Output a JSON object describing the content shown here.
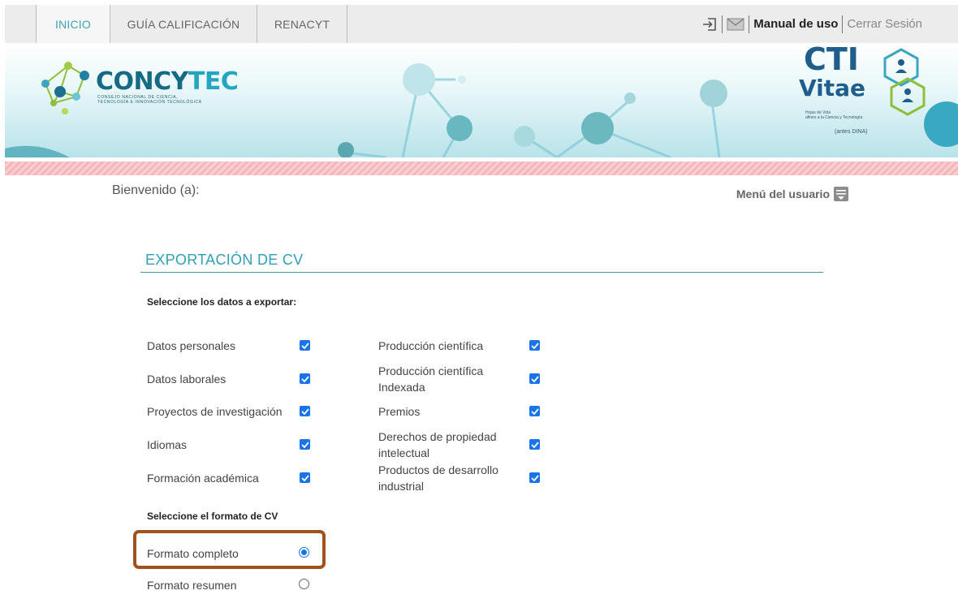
{
  "nav": {
    "tabs": [
      {
        "label": "INICIO",
        "active": true
      },
      {
        "label": "GUÍA CALIFICACIÓN",
        "active": false
      },
      {
        "label": "RENACYT",
        "active": false
      }
    ],
    "manual_label": "Manual de uso",
    "logout_label": "Cerrar Sesión",
    "icons": [
      "login-icon",
      "mail-icon"
    ]
  },
  "banner": {
    "logo_main": "CONCY",
    "logo_accent": "TEC",
    "logo_subtitle_1": "CONSEJO NACIONAL DE CIENCIA,",
    "logo_subtitle_2": "TECNOLOGÍA E INNOVACIÓN TECNOLÓGICA",
    "cti_title": "CTI",
    "cti_vitae": "Vitae",
    "cti_sub_1": "Hojas de Vida",
    "cti_sub_2": "afines a la Ciencia y Tecnología",
    "cti_antes": "(antes DINA)"
  },
  "welcome": "Bienvenido (a):",
  "user_menu_label": "Menú del usuario",
  "section_title": "EXPORTACIÓN DE CV",
  "select_data_label": "Seleccione los datos a exportar:",
  "left_options": [
    {
      "label": "Datos personales",
      "checked": true
    },
    {
      "label": "Datos laborales",
      "checked": true
    },
    {
      "label": "Proyectos de investigación",
      "checked": true
    },
    {
      "label": "Idiomas",
      "checked": true
    },
    {
      "label": "Formación académica",
      "checked": true
    }
  ],
  "right_options": [
    {
      "label": "Producción científica",
      "checked": true
    },
    {
      "label": "Producción científica Indexada",
      "checked": true
    },
    {
      "label": "Premios",
      "checked": true
    },
    {
      "label": "Derechos de propiedad intelectual",
      "checked": true
    },
    {
      "label": "Productos de desarrollo industrial",
      "checked": true
    }
  ],
  "select_format_label": "Seleccione el formato de CV",
  "formats": [
    {
      "label": "Formato completo",
      "selected": true
    },
    {
      "label": "Formato resumen",
      "selected": false
    }
  ],
  "colors": {
    "accent": "#30a0b6",
    "checkbox": "#1a73e8",
    "highlight": "#a0521e",
    "logo": "#166b84"
  }
}
